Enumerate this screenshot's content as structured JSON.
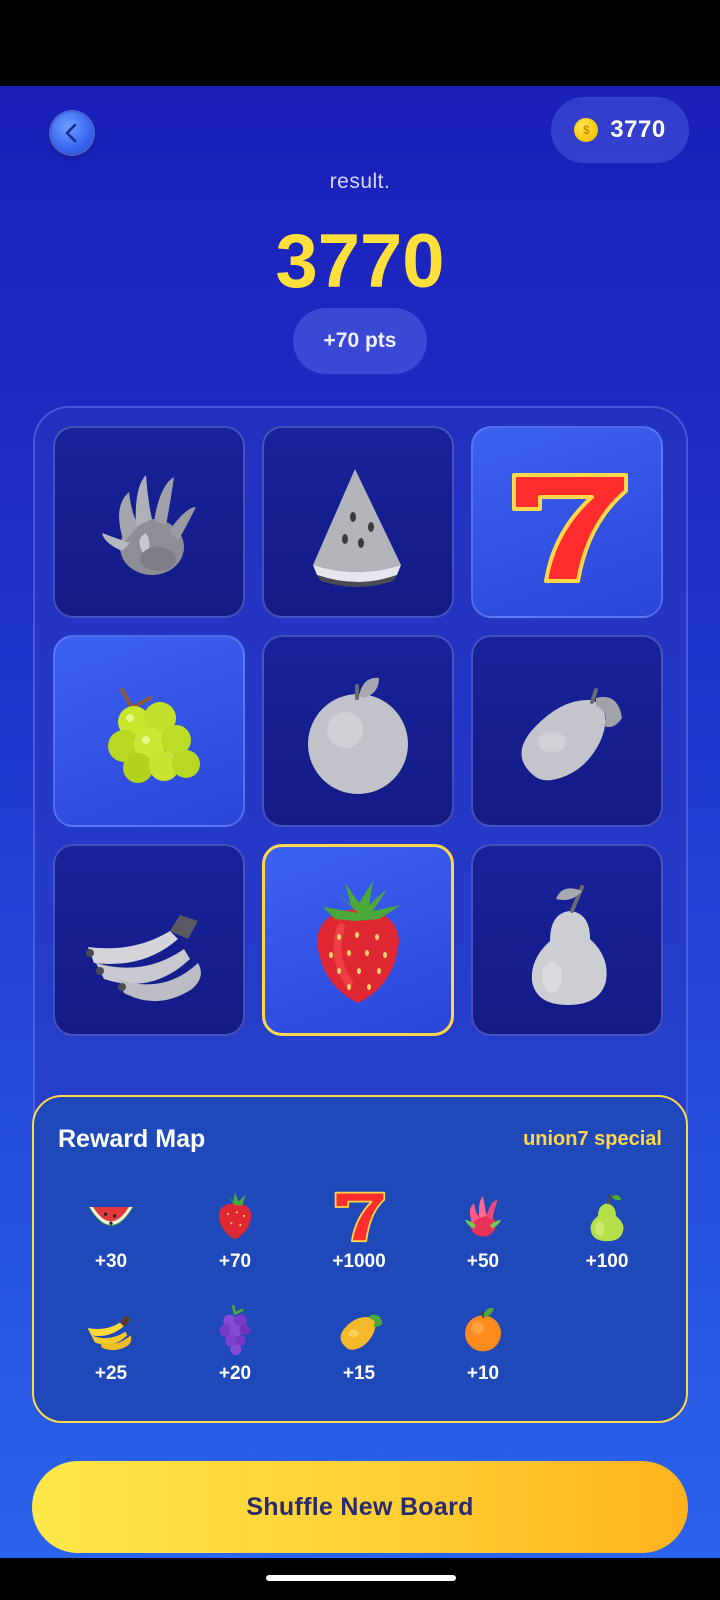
{
  "header": {
    "back_icon": "chevron-left-icon",
    "coin_icon": "gold-coin-icon",
    "coin_symbol": "$",
    "coin_balance": "3770"
  },
  "result": {
    "label": "result.",
    "score": "3770",
    "points_gained": "+70 pts"
  },
  "board": {
    "tiles": [
      {
        "symbol": "dragon-fruit",
        "state": "dimmed"
      },
      {
        "symbol": "watermelon",
        "state": "dimmed"
      },
      {
        "symbol": "seven",
        "state": "highlighted"
      },
      {
        "symbol": "grapes",
        "state": "highlighted"
      },
      {
        "symbol": "orange",
        "state": "dimmed"
      },
      {
        "symbol": "mango",
        "state": "dimmed"
      },
      {
        "symbol": "banana",
        "state": "dimmed"
      },
      {
        "symbol": "strawberry",
        "state": "selected"
      },
      {
        "symbol": "pear",
        "state": "dimmed"
      }
    ]
  },
  "reward_map": {
    "title": "Reward Map",
    "tag": "union7 special",
    "items": [
      {
        "symbol": "watermelon",
        "value": "+30"
      },
      {
        "symbol": "strawberry",
        "value": "+70"
      },
      {
        "symbol": "seven",
        "value": "+1000"
      },
      {
        "symbol": "dragon-fruit",
        "value": "+50"
      },
      {
        "symbol": "pear",
        "value": "+100"
      },
      {
        "symbol": "banana",
        "value": "+25"
      },
      {
        "symbol": "grapes",
        "value": "+20"
      },
      {
        "symbol": "mango",
        "value": "+15"
      },
      {
        "symbol": "orange",
        "value": "+10"
      }
    ]
  },
  "actions": {
    "shuffle_label": "Shuffle New Board"
  },
  "colors": {
    "accent_yellow": "#ffe03a",
    "selected_border": "#ffd84a",
    "background_top": "#1a1fb8",
    "background_bottom": "#2a63ec"
  }
}
